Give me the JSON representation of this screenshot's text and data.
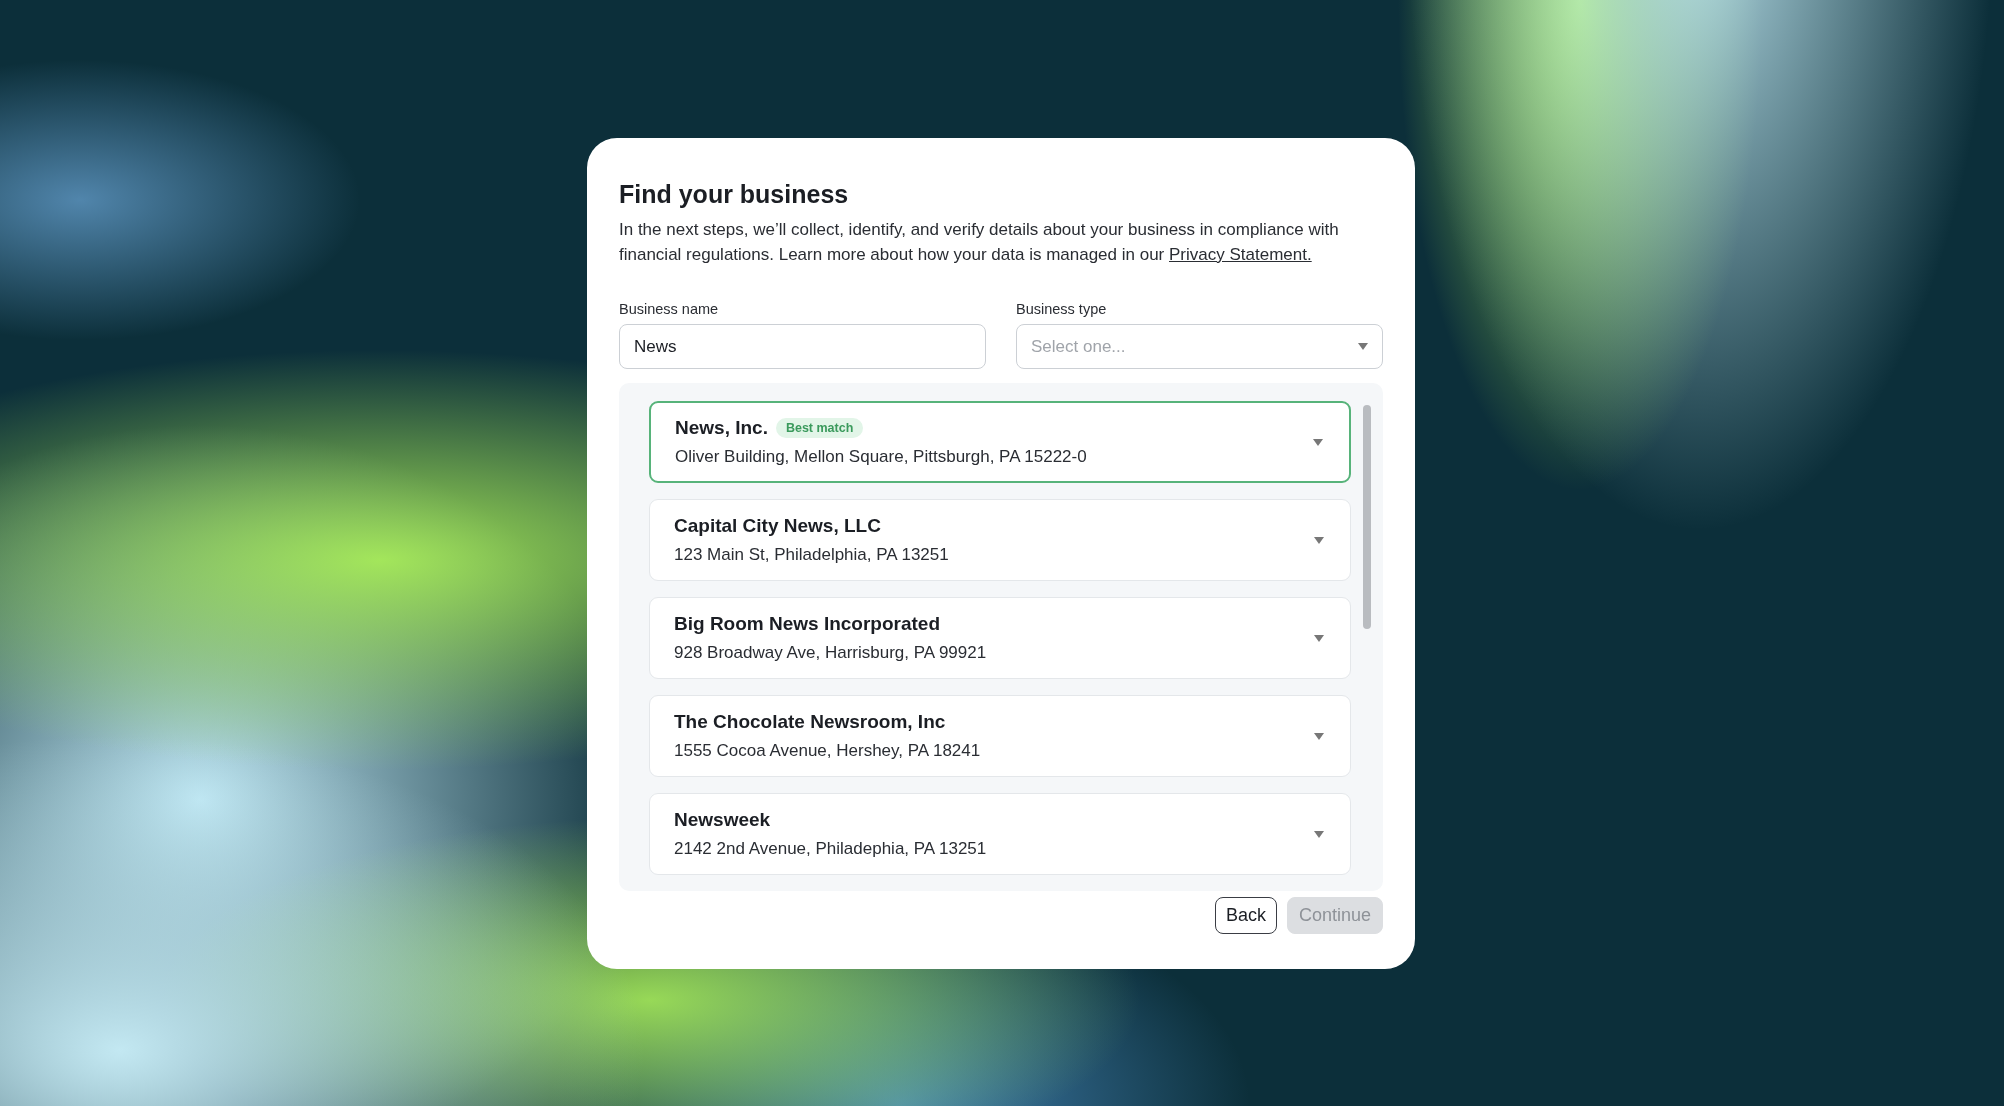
{
  "dialog": {
    "title": "Find your business",
    "description": "In the next steps, we’ll collect, identify, and verify details about your business in compliance with financial regulations. Learn more about how your data is managed in our ",
    "link": "Privacy Statement.",
    "fields": [
      {
        "kind": "text",
        "label": "Business name",
        "value": "News"
      },
      {
        "kind": "select",
        "label": "Business type",
        "placeholder": "Select one..."
      }
    ],
    "results": [
      {
        "name": "News, Inc.",
        "badge": "Best match",
        "address": "Oliver Building, Mellon Square, Pittsburgh, PA 15222-0",
        "selected": true
      },
      {
        "name": "Capital City News, LLC",
        "address": "123 Main St, Philadelphia, PA 13251",
        "selected": false
      },
      {
        "name": "Big Room News Incorporated",
        "address": "928 Broadway Ave, Harrisburg, PA 99921",
        "selected": false
      },
      {
        "name": "The Chocolate Newsroom, Inc",
        "address": "1555 Cocoa Avenue, Hershey, PA 18241",
        "selected": false
      },
      {
        "name": "Newsweek",
        "address": "2142 2nd Avenue, Philadephia, PA 13251",
        "selected": false
      }
    ],
    "buttons": [
      {
        "label": "Back",
        "disabled": false
      },
      {
        "label": "Continue",
        "disabled": true
      }
    ]
  }
}
